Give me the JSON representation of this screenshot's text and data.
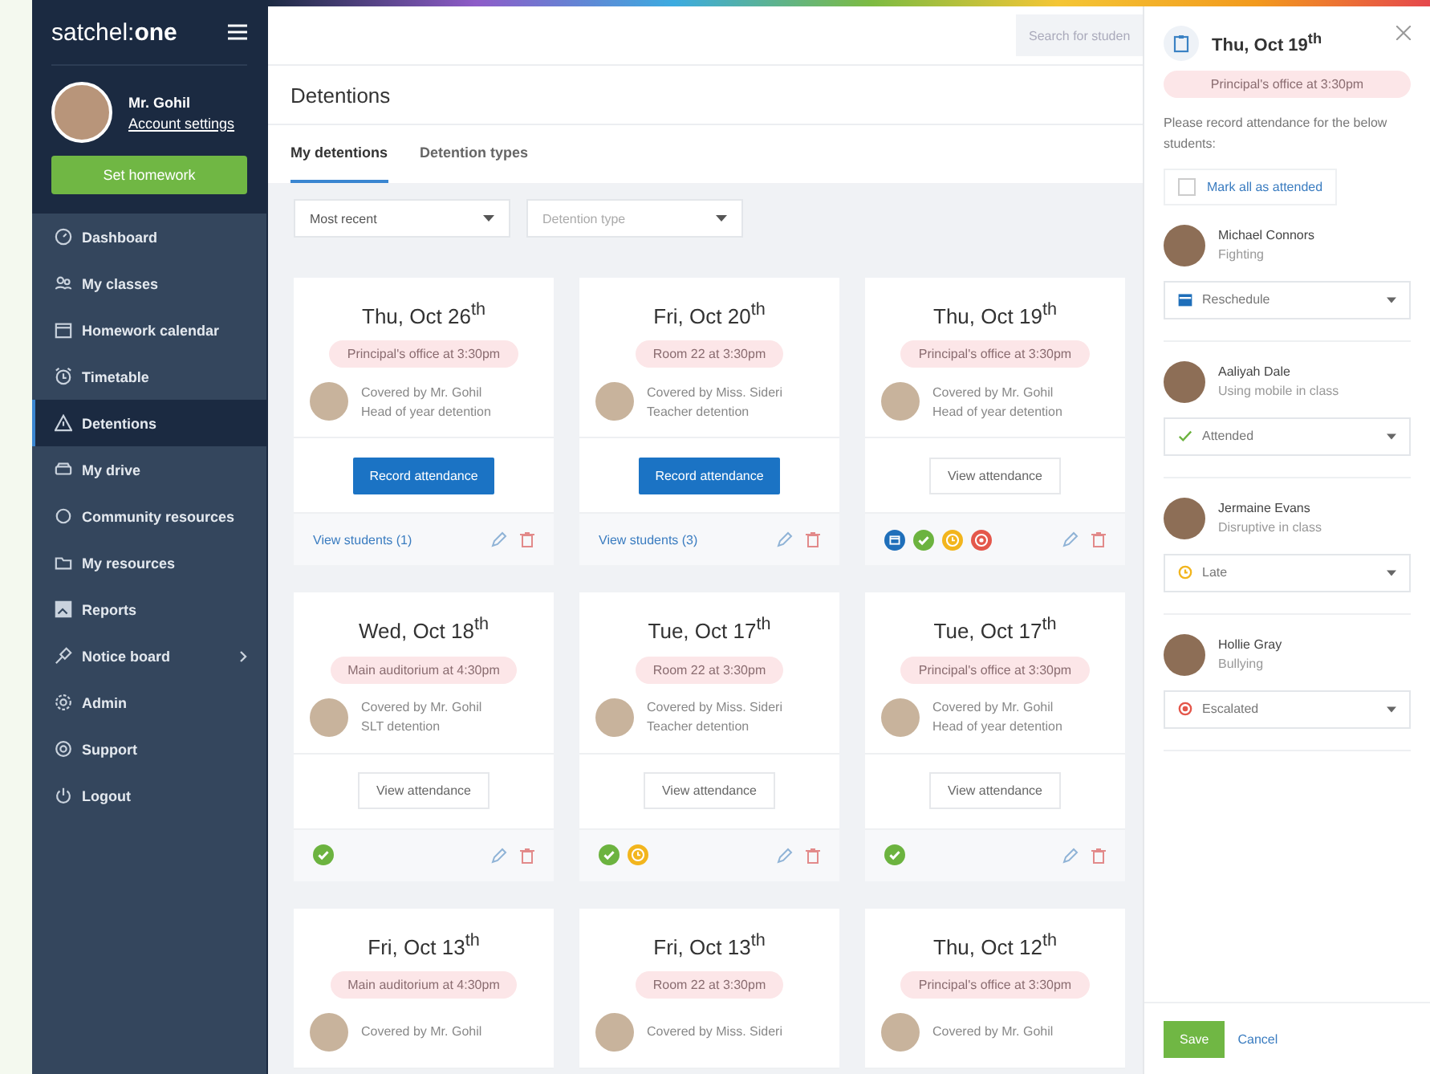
{
  "sidebar": {
    "logo": "satchel:**one**",
    "user": {
      "name": "Mr. Gohil",
      "account_link": "Account settings"
    },
    "set_homework": "Set homework",
    "items": [
      {
        "kind": "dashboard",
        "label": "Dashboard",
        "selected": false
      },
      {
        "kind": "classes",
        "label": "My classes",
        "selected": false
      },
      {
        "kind": "calendar",
        "label": "Homework calendar",
        "selected": false
      },
      {
        "kind": "timetable",
        "label": "Timetable",
        "selected": false
      },
      {
        "kind": "warning",
        "label": "Detentions",
        "selected": true
      },
      {
        "kind": "drive",
        "label": "My drive",
        "selected": false
      },
      {
        "kind": "community",
        "label": "Community resources",
        "selected": false
      },
      {
        "kind": "folder",
        "label": "My resources",
        "selected": false
      },
      {
        "kind": "reports",
        "label": "Reports",
        "selected": false
      },
      {
        "kind": "pin",
        "label": "Notice board",
        "selected": false,
        "has_submenu": true
      },
      {
        "kind": "gear",
        "label": "Admin",
        "selected": false
      },
      {
        "kind": "support",
        "label": "Support",
        "selected": false
      },
      {
        "kind": "power",
        "label": "Logout",
        "selected": false
      }
    ]
  },
  "search": {
    "placeholder": "Search for studen"
  },
  "page_title": "Detentions",
  "tabs": [
    {
      "label": "My detentions",
      "selected": true
    },
    {
      "label": "Detention types",
      "selected": false
    }
  ],
  "filters": [
    {
      "value": "Most recent"
    },
    {
      "placeholder": "Detention type"
    }
  ],
  "cards": [
    {
      "date": "Thu, Oct 26$^{th}$",
      "location": "Principal's office at 3:30pm",
      "teacher": "Covered by Mr. Gohil",
      "type": "Head of year detention",
      "action": {
        "kind": "record",
        "label": "Record attendance"
      },
      "students_link": "View students (1)"
    },
    {
      "date": "Fri, Oct 20$^{th}$",
      "location": "Room 22 at 3:30pm",
      "teacher": "Covered by Miss. Sideri",
      "type": "Teacher detention",
      "action": {
        "kind": "record",
        "label": "Record attendance"
      },
      "students_link": "View students (3)"
    },
    {
      "date": "Thu, Oct 19$^{th}$",
      "location": "Principal's office at 3:30pm",
      "teacher": "Covered by Mr. Gohil",
      "type": "Head of year detention",
      "action": {
        "kind": "view",
        "label": "View attendance"
      },
      "statuses": [
        {
          "kind": "rescheduled"
        },
        {
          "kind": "attended"
        },
        {
          "kind": "late"
        },
        {
          "kind": "escalated"
        }
      ]
    },
    {
      "date": "Wed, Oct 18$^{th}$",
      "location": "Main auditorium at 4:30pm",
      "teacher": "Covered by Mr. Gohil",
      "type": "SLT detention",
      "action": {
        "kind": "view",
        "label": "View attendance"
      },
      "statuses": [
        {
          "kind": "attended"
        }
      ]
    },
    {
      "date": "Tue, Oct 17$^{th}$",
      "location": "Room 22 at 3:30pm",
      "teacher": "Covered by Miss. Sideri",
      "type": "Teacher detention",
      "action": {
        "kind": "view",
        "label": "View attendance"
      },
      "statuses": [
        {
          "kind": "attended"
        },
        {
          "kind": "late"
        }
      ]
    },
    {
      "date": "Tue, Oct 17$^{th}$",
      "location": "Principal's office at 3:30pm",
      "teacher": "Covered by Mr. Gohil",
      "type": "Head of year detention",
      "action": {
        "kind": "view",
        "label": "View attendance"
      },
      "statuses": [
        {
          "kind": "attended"
        }
      ]
    },
    {
      "date": "Fri, Oct 13$^{th}$",
      "location": "Main auditorium at 4:30pm",
      "teacher": "Covered by Mr. Gohil"
    },
    {
      "date": "Fri, Oct 13$^{th}$",
      "location": "Room 22 at 3:30pm",
      "teacher": "Covered by Miss. Sideri"
    },
    {
      "date": "Thu, Oct 12$^{th}$",
      "location": "Principal's office at 3:30pm",
      "teacher": "Covered by Mr. Gohil"
    }
  ],
  "panel": {
    "date": "Thu, Oct 19$^{th}$",
    "location": "Principal's office at 3:30pm",
    "instruction": "Please record attendance for the below students:",
    "mark_all": {
      "label": "Mark all as attended",
      "checked": false
    },
    "students": [
      {
        "name": "Michael Connors",
        "reason": "Fighting",
        "status": {
          "kind": "rescheduled",
          "label": "Reschedule"
        }
      },
      {
        "name": "Aaliyah Dale",
        "reason": "Using mobile in class",
        "status": {
          "kind": "attended",
          "label": "Attended"
        }
      },
      {
        "name": "Jermaine Evans",
        "reason": "Disruptive in class",
        "status": {
          "kind": "late",
          "label": "Late"
        }
      },
      {
        "name": "Hollie Gray",
        "reason": "Bullying",
        "status": {
          "kind": "escalated",
          "label": "Escalated"
        }
      }
    ],
    "save": "Save",
    "cancel": "Cancel"
  }
}
